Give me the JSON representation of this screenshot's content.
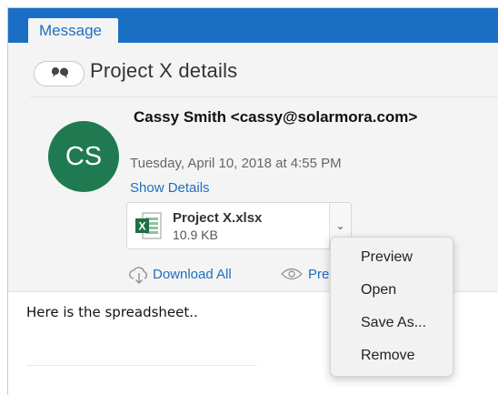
{
  "tabs": {
    "message_label": "Message"
  },
  "message": {
    "subject": "Project X details",
    "avatar_initials": "CS",
    "sender": "Cassy Smith <cassy@solarmora.com>",
    "date": "Tuesday, April 10, 2018 at 4:55 PM",
    "show_details_label": "Show Details",
    "body_text": "Here is the spreadsheet.."
  },
  "attachment": {
    "name": "Project X.xlsx",
    "size": "10.9 KB",
    "icon": "excel-file-icon",
    "chevron": "⌄"
  },
  "actions": {
    "download_all_label": "Download All",
    "preview_all_label": "Pre"
  },
  "context_menu": {
    "items": [
      "Preview",
      "Open",
      "Save As...",
      "Remove"
    ]
  },
  "colors": {
    "accent": "#1a6fc4",
    "link": "#1f6fbf",
    "avatar": "#1f7a52",
    "excel_green": "#1e7145"
  }
}
